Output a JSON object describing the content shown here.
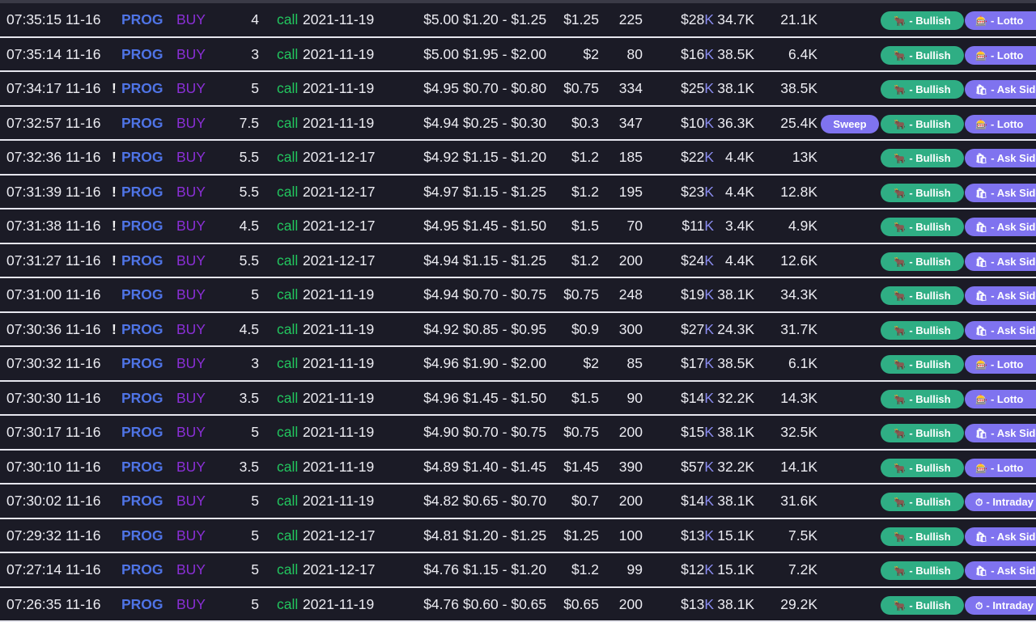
{
  "labels": {
    "sweep": "Sweep",
    "bullish": "- Bullish"
  },
  "tag_text": {
    "lotto": "- Lotto",
    "ask": "- Ask Side",
    "intraday": "- Intraday"
  },
  "tag_icons": {
    "lotto": "🎰",
    "ask": "🛍",
    "intraday": "⏱"
  },
  "bull_icon": "🐂",
  "alert_mark": "!",
  "k_suffix": "K",
  "colors": {
    "ticker": "#4f74e6",
    "side": "#8a2fd6",
    "call": "#22c55e",
    "bullish_pill": "#2fae84",
    "tag_pill": "#7f73ef",
    "background": "#1b1b26"
  },
  "rows": [
    {
      "time": "07:35:15 11-16",
      "alert": false,
      "ticker": "PROG",
      "side": "BUY",
      "strike": "4",
      "type": "call",
      "expiry": "2021-11-19",
      "spot": "$5.00",
      "bid_ask": "$1.20 - $1.25",
      "fill": "$1.25",
      "size": "225",
      "premium": "$28",
      "oi": "34.7K",
      "volume": "21.1K",
      "sweep": false,
      "tag": "lotto"
    },
    {
      "time": "07:35:14 11-16",
      "alert": false,
      "ticker": "PROG",
      "side": "BUY",
      "strike": "3",
      "type": "call",
      "expiry": "2021-11-19",
      "spot": "$5.00",
      "bid_ask": "$1.95 - $2.00",
      "fill": "$2",
      "size": "80",
      "premium": "$16",
      "oi": "38.5K",
      "volume": "6.4K",
      "sweep": false,
      "tag": "lotto"
    },
    {
      "time": "07:34:17 11-16",
      "alert": true,
      "ticker": "PROG",
      "side": "BUY",
      "strike": "5",
      "type": "call",
      "expiry": "2021-11-19",
      "spot": "$4.95",
      "bid_ask": "$0.70 - $0.80",
      "fill": "$0.75",
      "size": "334",
      "premium": "$25",
      "oi": "38.1K",
      "volume": "38.5K",
      "sweep": false,
      "tag": "ask"
    },
    {
      "time": "07:32:57 11-16",
      "alert": false,
      "ticker": "PROG",
      "side": "BUY",
      "strike": "7.5",
      "type": "call",
      "expiry": "2021-11-19",
      "spot": "$4.94",
      "bid_ask": "$0.25 - $0.30",
      "fill": "$0.3",
      "size": "347",
      "premium": "$10",
      "oi": "36.3K",
      "volume": "25.4K",
      "sweep": true,
      "tag": "lotto"
    },
    {
      "time": "07:32:36 11-16",
      "alert": true,
      "ticker": "PROG",
      "side": "BUY",
      "strike": "5.5",
      "type": "call",
      "expiry": "2021-12-17",
      "spot": "$4.92",
      "bid_ask": "$1.15 - $1.20",
      "fill": "$1.2",
      "size": "185",
      "premium": "$22",
      "oi": "4.4K",
      "volume": "13K",
      "sweep": false,
      "tag": "ask"
    },
    {
      "time": "07:31:39 11-16",
      "alert": true,
      "ticker": "PROG",
      "side": "BUY",
      "strike": "5.5",
      "type": "call",
      "expiry": "2021-12-17",
      "spot": "$4.97",
      "bid_ask": "$1.15 - $1.25",
      "fill": "$1.2",
      "size": "195",
      "premium": "$23",
      "oi": "4.4K",
      "volume": "12.8K",
      "sweep": false,
      "tag": "ask"
    },
    {
      "time": "07:31:38 11-16",
      "alert": true,
      "ticker": "PROG",
      "side": "BUY",
      "strike": "4.5",
      "type": "call",
      "expiry": "2021-12-17",
      "spot": "$4.95",
      "bid_ask": "$1.45 - $1.50",
      "fill": "$1.5",
      "size": "70",
      "premium": "$11",
      "oi": "3.4K",
      "volume": "4.9K",
      "sweep": false,
      "tag": "ask"
    },
    {
      "time": "07:31:27 11-16",
      "alert": true,
      "ticker": "PROG",
      "side": "BUY",
      "strike": "5.5",
      "type": "call",
      "expiry": "2021-12-17",
      "spot": "$4.94",
      "bid_ask": "$1.15 - $1.25",
      "fill": "$1.2",
      "size": "200",
      "premium": "$24",
      "oi": "4.4K",
      "volume": "12.6K",
      "sweep": false,
      "tag": "ask"
    },
    {
      "time": "07:31:00 11-16",
      "alert": false,
      "ticker": "PROG",
      "side": "BUY",
      "strike": "5",
      "type": "call",
      "expiry": "2021-11-19",
      "spot": "$4.94",
      "bid_ask": "$0.70 - $0.75",
      "fill": "$0.75",
      "size": "248",
      "premium": "$19",
      "oi": "38.1K",
      "volume": "34.3K",
      "sweep": false,
      "tag": "ask"
    },
    {
      "time": "07:30:36 11-16",
      "alert": true,
      "ticker": "PROG",
      "side": "BUY",
      "strike": "4.5",
      "type": "call",
      "expiry": "2021-11-19",
      "spot": "$4.92",
      "bid_ask": "$0.85 - $0.95",
      "fill": "$0.9",
      "size": "300",
      "premium": "$27",
      "oi": "24.3K",
      "volume": "31.7K",
      "sweep": false,
      "tag": "ask"
    },
    {
      "time": "07:30:32 11-16",
      "alert": false,
      "ticker": "PROG",
      "side": "BUY",
      "strike": "3",
      "type": "call",
      "expiry": "2021-11-19",
      "spot": "$4.96",
      "bid_ask": "$1.90 - $2.00",
      "fill": "$2",
      "size": "85",
      "premium": "$17",
      "oi": "38.5K",
      "volume": "6.1K",
      "sweep": false,
      "tag": "lotto"
    },
    {
      "time": "07:30:30 11-16",
      "alert": false,
      "ticker": "PROG",
      "side": "BUY",
      "strike": "3.5",
      "type": "call",
      "expiry": "2021-11-19",
      "spot": "$4.96",
      "bid_ask": "$1.45 - $1.50",
      "fill": "$1.5",
      "size": "90",
      "premium": "$14",
      "oi": "32.2K",
      "volume": "14.3K",
      "sweep": false,
      "tag": "lotto"
    },
    {
      "time": "07:30:17 11-16",
      "alert": false,
      "ticker": "PROG",
      "side": "BUY",
      "strike": "5",
      "type": "call",
      "expiry": "2021-11-19",
      "spot": "$4.90",
      "bid_ask": "$0.70 - $0.75",
      "fill": "$0.75",
      "size": "200",
      "premium": "$15",
      "oi": "38.1K",
      "volume": "32.5K",
      "sweep": false,
      "tag": "ask"
    },
    {
      "time": "07:30:10 11-16",
      "alert": false,
      "ticker": "PROG",
      "side": "BUY",
      "strike": "3.5",
      "type": "call",
      "expiry": "2021-11-19",
      "spot": "$4.89",
      "bid_ask": "$1.40 - $1.45",
      "fill": "$1.45",
      "size": "390",
      "premium": "$57",
      "oi": "32.2K",
      "volume": "14.1K",
      "sweep": false,
      "tag": "lotto"
    },
    {
      "time": "07:30:02 11-16",
      "alert": false,
      "ticker": "PROG",
      "side": "BUY",
      "strike": "5",
      "type": "call",
      "expiry": "2021-11-19",
      "spot": "$4.82",
      "bid_ask": "$0.65 - $0.70",
      "fill": "$0.7",
      "size": "200",
      "premium": "$14",
      "oi": "38.1K",
      "volume": "31.6K",
      "sweep": false,
      "tag": "intraday"
    },
    {
      "time": "07:29:32 11-16",
      "alert": false,
      "ticker": "PROG",
      "side": "BUY",
      "strike": "5",
      "type": "call",
      "expiry": "2021-12-17",
      "spot": "$4.81",
      "bid_ask": "$1.20 - $1.25",
      "fill": "$1.25",
      "size": "100",
      "premium": "$13",
      "oi": "15.1K",
      "volume": "7.5K",
      "sweep": false,
      "tag": "ask"
    },
    {
      "time": "07:27:14 11-16",
      "alert": false,
      "ticker": "PROG",
      "side": "BUY",
      "strike": "5",
      "type": "call",
      "expiry": "2021-12-17",
      "spot": "$4.76",
      "bid_ask": "$1.15 - $1.20",
      "fill": "$1.2",
      "size": "99",
      "premium": "$12",
      "oi": "15.1K",
      "volume": "7.2K",
      "sweep": false,
      "tag": "ask"
    },
    {
      "time": "07:26:35 11-16",
      "alert": false,
      "ticker": "PROG",
      "side": "BUY",
      "strike": "5",
      "type": "call",
      "expiry": "2021-11-19",
      "spot": "$4.76",
      "bid_ask": "$0.60 - $0.65",
      "fill": "$0.65",
      "size": "200",
      "premium": "$13",
      "oi": "38.1K",
      "volume": "29.2K",
      "sweep": false,
      "tag": "intraday"
    }
  ]
}
